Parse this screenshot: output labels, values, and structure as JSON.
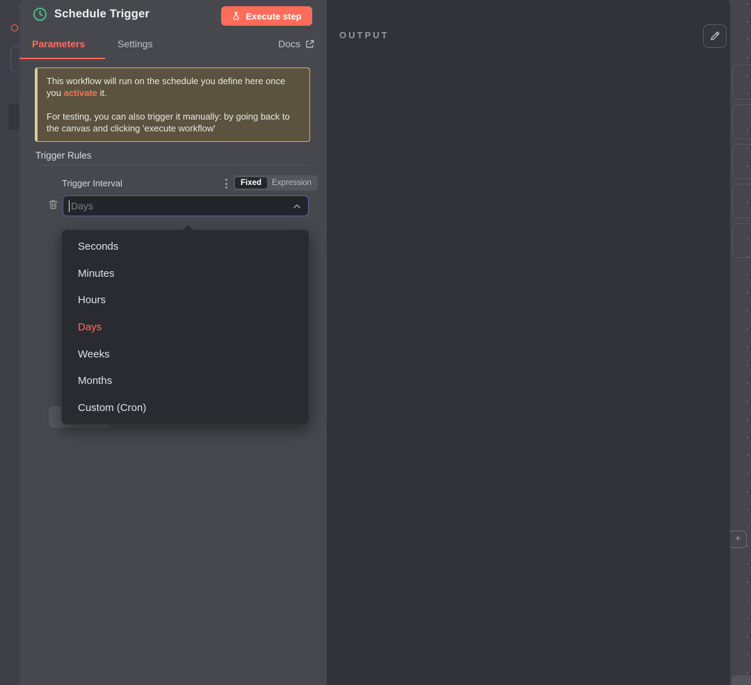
{
  "node_panel": {
    "title": "Schedule Trigger",
    "execute_button_label": "Execute step",
    "tabs": [
      {
        "label": "Parameters"
      },
      {
        "label": "Settings"
      }
    ],
    "docs_label": "Docs",
    "notice": {
      "line1_before": "This workflow will run on the schedule you define here once you ",
      "line1_link": "activate",
      "line1_after": " it.",
      "line2": "For testing, you can also trigger it manually: by going back to the canvas and clicking 'execute workflow'"
    },
    "section_title": "Trigger Rules",
    "parameter": {
      "label": "Trigger Interval",
      "mode_fixed": "Fixed",
      "mode_expression": "Expression",
      "active_mode": "Fixed",
      "value": "Days"
    },
    "dropdown_options": [
      "Seconds",
      "Minutes",
      "Hours",
      "Days",
      "Weeks",
      "Months",
      "Custom (Cron)"
    ],
    "dropdown_selected": "Days"
  },
  "output_panel": {
    "title": "OUTPUT"
  },
  "side_controls": {
    "plus_label": "+"
  },
  "colors": {
    "accent": "#ff6d5a",
    "clock_icon": "#4dbd8b",
    "notice_bg": "#5b533f",
    "notice_border": "#c9b586",
    "input_focus_border": "#5f5da8"
  }
}
